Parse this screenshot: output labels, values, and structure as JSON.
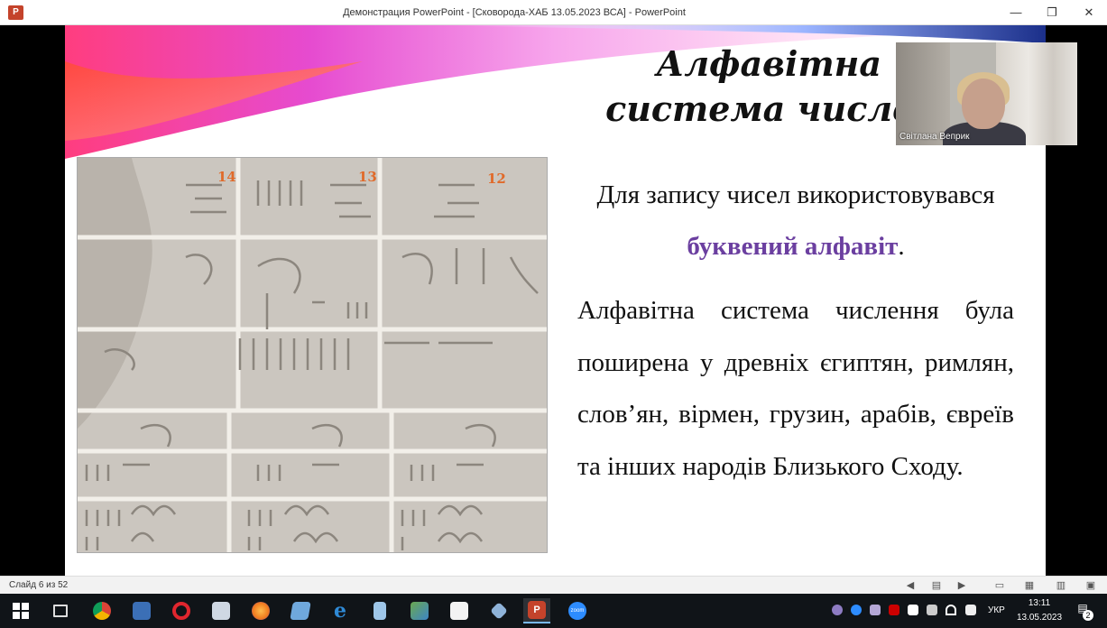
{
  "window": {
    "app_icon": "P",
    "title": "Демонстрация PowerPoint - [Сковорода-ХАБ 13.05.2023 ВСА] - PowerPoint",
    "minimize": "—",
    "restore": "❐",
    "close": "✕"
  },
  "slide": {
    "title_line1": "Алфавітна",
    "title_line2": "система числення",
    "photo_labels": [
      "14",
      "13",
      "12"
    ],
    "p1_before": "Для запису чисел використовувався",
    "p1_accent": "буквений алфавіт",
    "p1_after": ".",
    "p2": "Алфавітна система числення була поширена у древніх єгиптян, римлян, слов’ян, вірмен, грузин, арабів, євреїв та інших народів Близького Сходу.",
    "accent_color": "#6b3fa0"
  },
  "video": {
    "participant_name": "Світлана Веприк"
  },
  "statusbar": {
    "slide_counter": "Слайд 6 из 52"
  },
  "taskbar": {
    "apps": [
      {
        "name": "windows-start",
        "color": "#ffffff"
      },
      {
        "name": "task-view",
        "color": "#dddddd"
      },
      {
        "name": "chrome",
        "color": "#e8b21e"
      },
      {
        "name": "save-floppy",
        "color": "#3b6fb6"
      },
      {
        "name": "opera",
        "color": "#e0262e"
      },
      {
        "name": "mail-app",
        "color": "#cfd8e3"
      },
      {
        "name": "firefox",
        "color": "#f07b1e"
      },
      {
        "name": "notebook-app",
        "color": "#6fa8dc"
      },
      {
        "name": "internet-explorer",
        "color": "#2f8ad6"
      },
      {
        "name": "notepad",
        "color": "#9ec6e8"
      },
      {
        "name": "network-app",
        "color": "#6aa84f"
      },
      {
        "name": "files-app",
        "color": "#f3f3f3"
      },
      {
        "name": "tools-app",
        "color": "#8fb3d9"
      },
      {
        "name": "powerpoint",
        "color": "#c4432b"
      },
      {
        "name": "zoom",
        "color": "#2d8cff"
      }
    ],
    "language": "УКР",
    "time": "13:11",
    "date": "13.05.2023",
    "notification_count": "2"
  }
}
